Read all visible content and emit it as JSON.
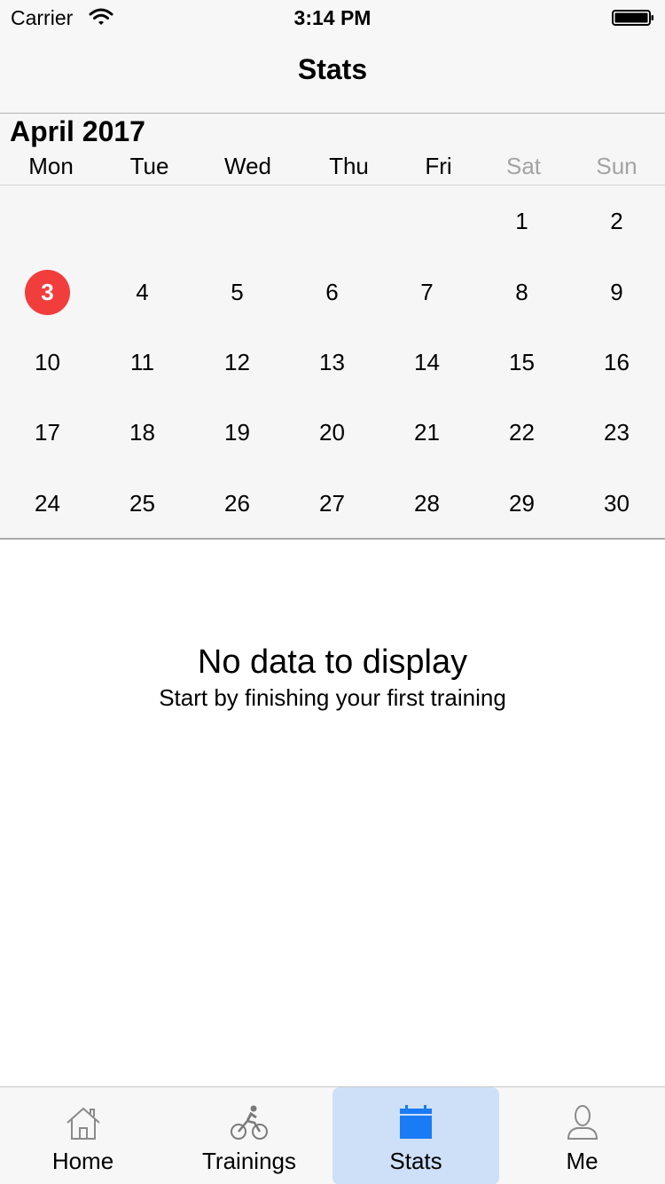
{
  "status_bar": {
    "carrier": "Carrier",
    "time": "3:14 PM"
  },
  "nav": {
    "title": "Stats"
  },
  "calendar": {
    "month_title": "April 2017",
    "weekdays": [
      "Mon",
      "Tue",
      "Wed",
      "Thu",
      "Fri",
      "Sat",
      "Sun"
    ],
    "weeks": [
      [
        "",
        "",
        "",
        "",
        "",
        "1",
        "2"
      ],
      [
        "3",
        "4",
        "5",
        "6",
        "7",
        "8",
        "9"
      ],
      [
        "10",
        "11",
        "12",
        "13",
        "14",
        "15",
        "16"
      ],
      [
        "17",
        "18",
        "19",
        "20",
        "21",
        "22",
        "23"
      ],
      [
        "24",
        "25",
        "26",
        "27",
        "28",
        "29",
        "30"
      ]
    ],
    "today": "3",
    "today_color": "#f23d3d",
    "weekend_color": "#a3a3a3"
  },
  "empty_state": {
    "title": "No data to display",
    "subtitle": "Start by finishing your first training"
  },
  "tabs": [
    {
      "label": "Home",
      "icon": "home-icon",
      "active": false
    },
    {
      "label": "Trainings",
      "icon": "bicycle-icon",
      "active": false
    },
    {
      "label": "Stats",
      "icon": "calendar-icon",
      "active": true
    },
    {
      "label": "Me",
      "icon": "person-icon",
      "active": false
    }
  ],
  "accent_color": "#1a7cf5"
}
